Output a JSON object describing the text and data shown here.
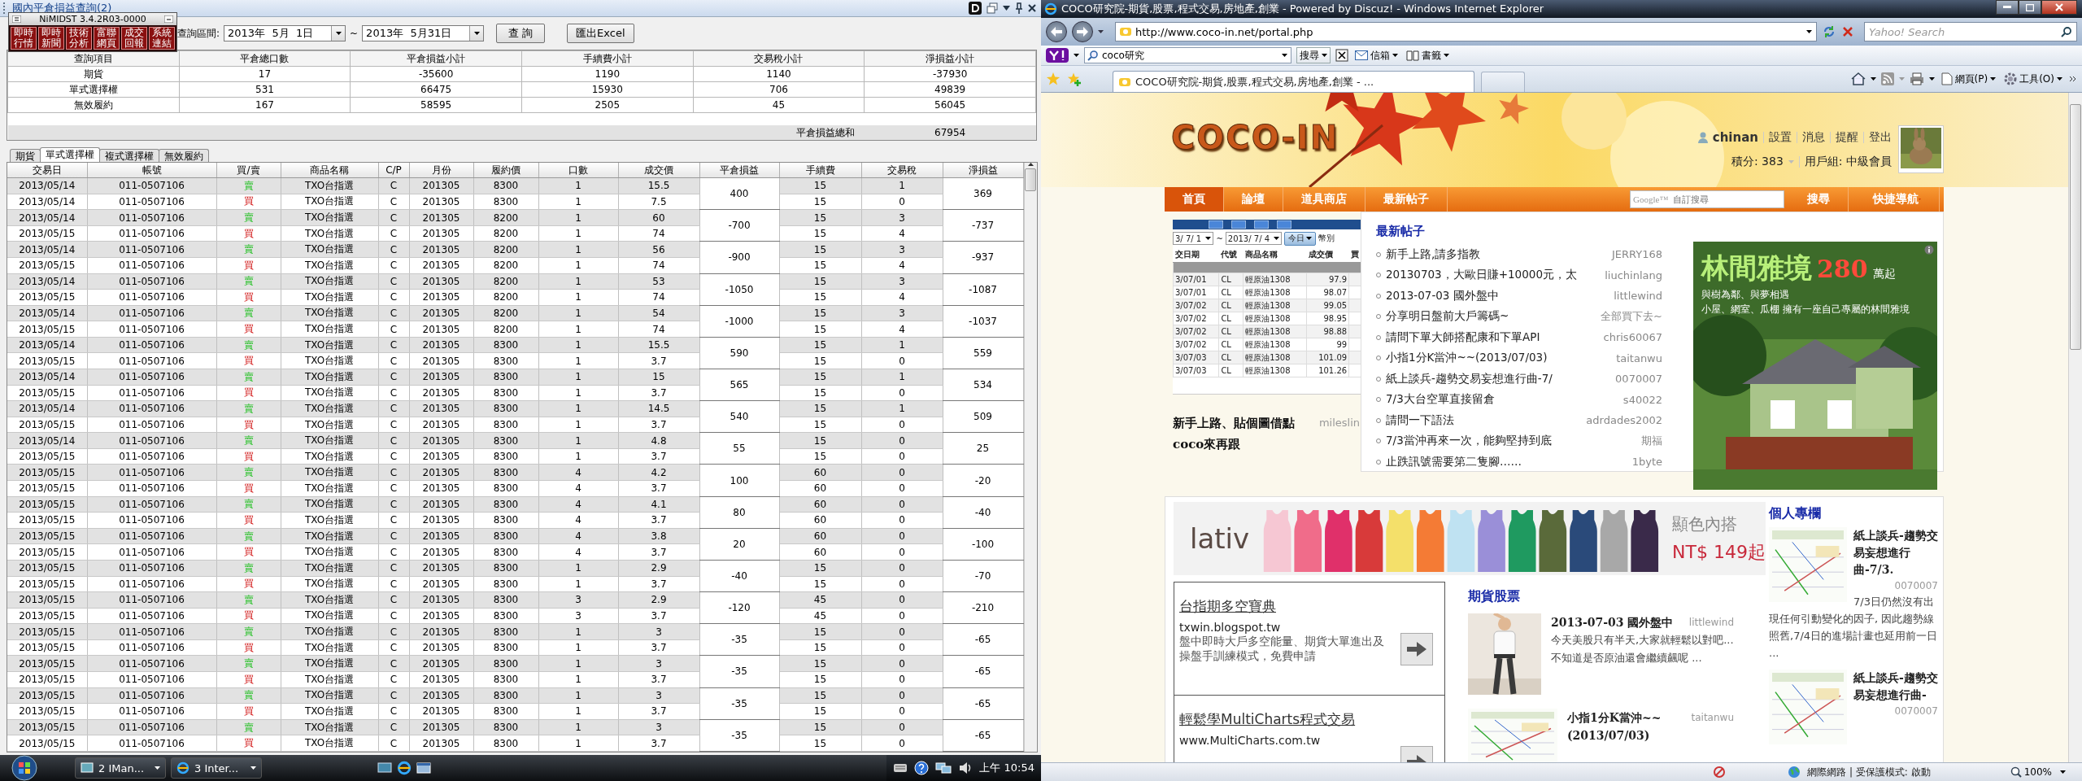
{
  "trade_window": {
    "title": "國內平倉損益查詢(2)",
    "floating_panel": {
      "title": "NiMIDST 3.4.2R03-0000",
      "buttons": [
        "即時行情",
        "即時新聞",
        "技術分析",
        "富聯網頁",
        "成交回報",
        "系統連結"
      ]
    },
    "query": {
      "label": "查詢區間:",
      "from": "2013年  5月  1日",
      "separator": "~",
      "to": "2013年  5月31日",
      "buttons": [
        "查 詢",
        "匯出Excel"
      ]
    },
    "summary": {
      "columns": [
        "查詢項目",
        "平倉總口數",
        "平倉損益小計",
        "手續費小計",
        "交易稅小計",
        "淨損益小計"
      ],
      "rows": [
        [
          "期貨",
          "17",
          "-35600",
          "1190",
          "1140",
          "-37930"
        ],
        [
          "單式選擇權",
          "531",
          "66475",
          "15930",
          "706",
          "49839"
        ],
        [
          "無效履約",
          "167",
          "58595",
          "2505",
          "45",
          "56045"
        ]
      ],
      "total_label": "平倉損益總和",
      "total": "67954"
    },
    "tabs": [
      {
        "label": "期貨",
        "selected": false
      },
      {
        "label": "單式選擇權",
        "selected": true
      },
      {
        "label": "複式選擇權",
        "selected": false
      },
      {
        "label": "無效履約",
        "selected": false
      }
    ],
    "detail": {
      "columns": [
        "交易日",
        "帳號",
        "買/賣",
        "商品名稱",
        "C/P",
        "月份",
        "履約價",
        "口數",
        "成交價",
        "平倉損益",
        "手續費",
        "交易稅",
        "淨損益"
      ],
      "trades": [
        {
          "pnl": "400",
          "net": "369",
          "legs": [
            {
              "kind": "sell",
              "cells": [
                "2013/05/14",
                "011-0507106",
                "賣",
                "TXO台指選",
                "C",
                "201305",
                "8300",
                "1",
                "15.5",
                "15",
                "1"
              ]
            },
            {
              "kind": "buy",
              "cells": [
                "2013/05/14",
                "011-0507106",
                "買",
                "TXO台指選",
                "C",
                "201305",
                "8300",
                "1",
                "7.5",
                "15",
                "0"
              ]
            }
          ]
        },
        {
          "pnl": "-700",
          "net": "-737",
          "legs": [
            {
              "kind": "sell",
              "cells": [
                "2013/05/14",
                "011-0507106",
                "賣",
                "TXO台指選",
                "C",
                "201305",
                "8200",
                "1",
                "60",
                "15",
                "3"
              ]
            },
            {
              "kind": "buy",
              "cells": [
                "2013/05/15",
                "011-0507106",
                "買",
                "TXO台指選",
                "C",
                "201305",
                "8200",
                "1",
                "74",
                "15",
                "4"
              ]
            }
          ]
        },
        {
          "pnl": "-900",
          "net": "-937",
          "legs": [
            {
              "kind": "sell",
              "cells": [
                "2013/05/14",
                "011-0507106",
                "賣",
                "TXO台指選",
                "C",
                "201305",
                "8200",
                "1",
                "56",
                "15",
                "3"
              ]
            },
            {
              "kind": "buy",
              "cells": [
                "2013/05/15",
                "011-0507106",
                "買",
                "TXO台指選",
                "C",
                "201305",
                "8200",
                "1",
                "74",
                "15",
                "4"
              ]
            }
          ]
        },
        {
          "pnl": "-1050",
          "net": "-1087",
          "legs": [
            {
              "kind": "sell",
              "cells": [
                "2013/05/14",
                "011-0507106",
                "賣",
                "TXO台指選",
                "C",
                "201305",
                "8200",
                "1",
                "53",
                "15",
                "3"
              ]
            },
            {
              "kind": "buy",
              "cells": [
                "2013/05/15",
                "011-0507106",
                "買",
                "TXO台指選",
                "C",
                "201305",
                "8200",
                "1",
                "74",
                "15",
                "4"
              ]
            }
          ]
        },
        {
          "pnl": "-1000",
          "net": "-1037",
          "legs": [
            {
              "kind": "sell",
              "cells": [
                "2013/05/14",
                "011-0507106",
                "賣",
                "TXO台指選",
                "C",
                "201305",
                "8200",
                "1",
                "54",
                "15",
                "3"
              ]
            },
            {
              "kind": "buy",
              "cells": [
                "2013/05/15",
                "011-0507106",
                "買",
                "TXO台指選",
                "C",
                "201305",
                "8200",
                "1",
                "74",
                "15",
                "4"
              ]
            }
          ]
        },
        {
          "pnl": "590",
          "net": "559",
          "legs": [
            {
              "kind": "sell",
              "cells": [
                "2013/05/14",
                "011-0507106",
                "賣",
                "TXO台指選",
                "C",
                "201305",
                "8300",
                "1",
                "15.5",
                "15",
                "1"
              ]
            },
            {
              "kind": "buy",
              "cells": [
                "2013/05/15",
                "011-0507106",
                "買",
                "TXO台指選",
                "C",
                "201305",
                "8300",
                "1",
                "3.7",
                "15",
                "0"
              ]
            }
          ]
        },
        {
          "pnl": "565",
          "net": "534",
          "legs": [
            {
              "kind": "sell",
              "cells": [
                "2013/05/14",
                "011-0507106",
                "賣",
                "TXO台指選",
                "C",
                "201305",
                "8300",
                "1",
                "15",
                "15",
                "1"
              ]
            },
            {
              "kind": "buy",
              "cells": [
                "2013/05/15",
                "011-0507106",
                "買",
                "TXO台指選",
                "C",
                "201305",
                "8300",
                "1",
                "3.7",
                "15",
                "0"
              ]
            }
          ]
        },
        {
          "pnl": "540",
          "net": "509",
          "legs": [
            {
              "kind": "sell",
              "cells": [
                "2013/05/14",
                "011-0507106",
                "賣",
                "TXO台指選",
                "C",
                "201305",
                "8300",
                "1",
                "14.5",
                "15",
                "1"
              ]
            },
            {
              "kind": "buy",
              "cells": [
                "2013/05/15",
                "011-0507106",
                "買",
                "TXO台指選",
                "C",
                "201305",
                "8300",
                "1",
                "3.7",
                "15",
                "0"
              ]
            }
          ]
        },
        {
          "pnl": "55",
          "net": "25",
          "legs": [
            {
              "kind": "sell",
              "cells": [
                "2013/05/14",
                "011-0507106",
                "賣",
                "TXO台指選",
                "C",
                "201305",
                "8300",
                "1",
                "4.8",
                "15",
                "0"
              ]
            },
            {
              "kind": "buy",
              "cells": [
                "2013/05/15",
                "011-0507106",
                "買",
                "TXO台指選",
                "C",
                "201305",
                "8300",
                "1",
                "3.7",
                "15",
                "0"
              ]
            }
          ]
        },
        {
          "pnl": "100",
          "net": "-20",
          "legs": [
            {
              "kind": "sell",
              "cells": [
                "2013/05/15",
                "011-0507106",
                "賣",
                "TXO台指選",
                "C",
                "201305",
                "8300",
                "4",
                "4.2",
                "60",
                "0"
              ]
            },
            {
              "kind": "buy",
              "cells": [
                "2013/05/15",
                "011-0507106",
                "買",
                "TXO台指選",
                "C",
                "201305",
                "8300",
                "4",
                "3.7",
                "60",
                "0"
              ]
            }
          ]
        },
        {
          "pnl": "80",
          "net": "-40",
          "legs": [
            {
              "kind": "sell",
              "cells": [
                "2013/05/15",
                "011-0507106",
                "賣",
                "TXO台指選",
                "C",
                "201305",
                "8300",
                "4",
                "4.1",
                "60",
                "0"
              ]
            },
            {
              "kind": "buy",
              "cells": [
                "2013/05/15",
                "011-0507106",
                "買",
                "TXO台指選",
                "C",
                "201305",
                "8300",
                "4",
                "3.7",
                "60",
                "0"
              ]
            }
          ]
        },
        {
          "pnl": "20",
          "net": "-100",
          "legs": [
            {
              "kind": "sell",
              "cells": [
                "2013/05/15",
                "011-0507106",
                "賣",
                "TXO台指選",
                "C",
                "201305",
                "8300",
                "4",
                "3.8",
                "60",
                "0"
              ]
            },
            {
              "kind": "buy",
              "cells": [
                "2013/05/15",
                "011-0507106",
                "買",
                "TXO台指選",
                "C",
                "201305",
                "8300",
                "4",
                "3.7",
                "60",
                "0"
              ]
            }
          ]
        },
        {
          "pnl": "-40",
          "net": "-70",
          "legs": [
            {
              "kind": "sell",
              "cells": [
                "2013/05/15",
                "011-0507106",
                "賣",
                "TXO台指選",
                "C",
                "201305",
                "8300",
                "1",
                "2.9",
                "15",
                "0"
              ]
            },
            {
              "kind": "buy",
              "cells": [
                "2013/05/15",
                "011-0507106",
                "買",
                "TXO台指選",
                "C",
                "201305",
                "8300",
                "1",
                "3.7",
                "15",
                "0"
              ]
            }
          ]
        },
        {
          "pnl": "-120",
          "net": "-210",
          "legs": [
            {
              "kind": "sell",
              "cells": [
                "2013/05/15",
                "011-0507106",
                "賣",
                "TXO台指選",
                "C",
                "201305",
                "8300",
                "3",
                "2.9",
                "45",
                "0"
              ]
            },
            {
              "kind": "buy",
              "cells": [
                "2013/05/15",
                "011-0507106",
                "買",
                "TXO台指選",
                "C",
                "201305",
                "8300",
                "3",
                "3.7",
                "45",
                "0"
              ]
            }
          ]
        },
        {
          "pnl": "-35",
          "net": "-65",
          "legs": [
            {
              "kind": "sell",
              "cells": [
                "2013/05/15",
                "011-0507106",
                "賣",
                "TXO台指選",
                "C",
                "201305",
                "8300",
                "1",
                "3",
                "15",
                "0"
              ]
            },
            {
              "kind": "buy",
              "cells": [
                "2013/05/15",
                "011-0507106",
                "買",
                "TXO台指選",
                "C",
                "201305",
                "8300",
                "1",
                "3.7",
                "15",
                "0"
              ]
            }
          ]
        },
        {
          "pnl": "-35",
          "net": "-65",
          "legs": [
            {
              "kind": "sell",
              "cells": [
                "2013/05/15",
                "011-0507106",
                "賣",
                "TXO台指選",
                "C",
                "201305",
                "8300",
                "1",
                "3",
                "15",
                "0"
              ]
            },
            {
              "kind": "buy",
              "cells": [
                "2013/05/15",
                "011-0507106",
                "買",
                "TXO台指選",
                "C",
                "201305",
                "8300",
                "1",
                "3.7",
                "15",
                "0"
              ]
            }
          ]
        },
        {
          "pnl": "-35",
          "net": "-65",
          "legs": [
            {
              "kind": "sell",
              "cells": [
                "2013/05/15",
                "011-0507106",
                "賣",
                "TXO台指選",
                "C",
                "201305",
                "8300",
                "1",
                "3",
                "15",
                "0"
              ]
            },
            {
              "kind": "buy",
              "cells": [
                "2013/05/15",
                "011-0507106",
                "買",
                "TXO台指選",
                "C",
                "201305",
                "8300",
                "1",
                "3.7",
                "15",
                "0"
              ]
            }
          ]
        },
        {
          "pnl": "-35",
          "net": "-65",
          "legs": [
            {
              "kind": "sell",
              "cells": [
                "2013/05/15",
                "011-0507106",
                "賣",
                "TXO台指選",
                "C",
                "201305",
                "8300",
                "1",
                "3",
                "15",
                "0"
              ]
            },
            {
              "kind": "buy",
              "cells": [
                "2013/05/15",
                "011-0507106",
                "買",
                "TXO台指選",
                "C",
                "201305",
                "8300",
                "1",
                "3.7",
                "15",
                "0"
              ]
            }
          ]
        }
      ]
    }
  },
  "taskbar": {
    "buttons": [
      "2 IMan...",
      "3 Inter..."
    ],
    "clock": "上午 10:54"
  },
  "browser": {
    "title": "COCO研究院-期貨,股票,程式交易,房地產,創業 - Powered by Discuz! - Windows Internet Explorer",
    "address": "http://www.coco-in.net/portal.php",
    "search_placeholder": "Yahoo! Search",
    "yahoo_toolbar": {
      "search_value": "coco研究",
      "search_button": "搜尋",
      "items": [
        "信箱",
        "書籤"
      ]
    },
    "tab": "COCO研究院-期貨,股票,程式交易,房地產,創業 - ...",
    "command_bar": [
      "網頁(P)",
      "工具(O)"
    ],
    "page": {
      "logo": "COCO-IN",
      "user": {
        "name": "chinan",
        "links": [
          "設置",
          "消息",
          "提醒",
          "登出"
        ],
        "points": "積分: 383",
        "group": "用戶組: 中級會員"
      },
      "nav": [
        {
          "label": "首頁",
          "selected": true
        },
        {
          "label": "論壇",
          "selected": false
        },
        {
          "label": "道具商店",
          "selected": false
        },
        {
          "label": "最新帖子",
          "selected": false
        }
      ],
      "site_search": {
        "brand": "Google™",
        "placeholder": "自訂搜尋",
        "button": "搜尋"
      },
      "quick_nav": "快捷導航",
      "snapshot": {
        "from": "3/ 7/ 1",
        "separator": "~",
        "to": "2013/ 7/ 4",
        "today": "今日",
        "currency": "幣別",
        "columns": [
          "交日期",
          "代號",
          "商品名稱",
          "成交價",
          "買"
        ],
        "rows": [
          [
            "3/07/01",
            "CL",
            "輕原油1308",
            "97.9"
          ],
          [
            "3/07/01",
            "CL",
            "輕原油1308",
            "98.07"
          ],
          [
            "3/07/02",
            "CL",
            "輕原油1308",
            "99.05"
          ],
          [
            "3/07/02",
            "CL",
            "輕原油1308",
            "98.95"
          ],
          [
            "3/07/02",
            "CL",
            "輕原油1308",
            "98.88"
          ],
          [
            "3/07/02",
            "CL",
            "輕原油1308",
            "99"
          ],
          [
            "3/07/03",
            "CL",
            "輕原油1308",
            "101.09"
          ],
          [
            "3/07/03",
            "CL",
            "輕原油1308",
            "101.26"
          ]
        ]
      },
      "featured_post": {
        "title": "新手上路、貼個圖借點coco來再跟",
        "author": "mileslin"
      },
      "latest": {
        "title": "最新帖子",
        "posts": [
          {
            "title": "新手上路,請多指教",
            "author": "JERRY168"
          },
          {
            "title": "20130703，大歐日賺+10000元，太",
            "author": "liuchinlang"
          },
          {
            "title": "2013-07-03 國外盤中",
            "author": "littlewind"
          },
          {
            "title": "分享明日盤前大戶籌碼~",
            "author": "全部買下去~"
          },
          {
            "title": "請問下單大師搭配康和下單API",
            "author": "chris60067"
          },
          {
            "title": "小指1分K當沖~~(2013/07/03)",
            "author": "taitanwu"
          },
          {
            "title": "紙上談兵-趨勢交易妄想進行曲-7/",
            "author": "0070007"
          },
          {
            "title": "7/3大台空單直接留倉",
            "author": "s40022"
          },
          {
            "title": "請問一下語法",
            "author": "adrdades2002"
          },
          {
            "title": "7/3當沖再來一次，能夠堅持到底",
            "author": "期福"
          },
          {
            "title": "止跌訊號需要第二隻腳……",
            "author": "1byte"
          }
        ]
      },
      "house_ad": {
        "title": "林間雅境",
        "price": "280",
        "unit": "萬起",
        "lines": [
          "與樹為鄰、與夢相遇",
          "小屋、網室、瓜棚 擁有一座自己專屬的林間雅境"
        ]
      },
      "lativ_ad": {
        "brand": "lativ",
        "tagline": "顯色內搭",
        "price": "NT$ 149起"
      },
      "text_ads": [
        {
          "title": "台指期多空寶典",
          "url": "txwin.blogspot.tw",
          "description": "盤中即時大戶多空能量、期貨大單進出及操盤手訓練模式，免費申請"
        },
        {
          "title": "輕鬆學MultiCharts程式交易",
          "url": "www.MultiCharts.com.tw"
        }
      ],
      "futures": {
        "title": "期貨股票",
        "posts": [
          {
            "title": "2013-07-03 國外盤中",
            "author": "littlewind",
            "excerpt": "今天美股只有半天,大家就輕鬆以對吧... 不知道是否原油還會繼續飆呢 ..."
          },
          {
            "title": "小指1分K當沖~~(2013/07/03)",
            "author": "taitanwu"
          }
        ]
      },
      "column": {
        "title": "個人專欄",
        "posts": [
          {
            "title": "紙上談兵-趨勢交易妄想進行曲-7/3.",
            "author": "0070007",
            "excerpt": "7/3日仍然沒有出現任何引動變化的因子, 因此趨勢線照舊,7/4日的進場計畫也延用前一日 ..."
          },
          {
            "title": "紙上談兵-趨勢交易妄想進行曲-",
            "author": "0070007"
          }
        ]
      }
    },
    "status_bar": {
      "zone": "網際網路 | 受保護模式: 啟動",
      "zoom": "100%"
    }
  }
}
